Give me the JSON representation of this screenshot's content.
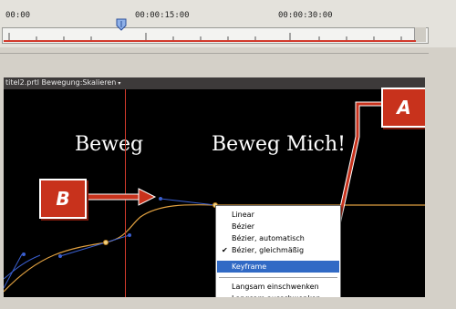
{
  "timeline": {
    "timecodes": [
      "00:00",
      "00:00:15:00",
      "00:00:30:00"
    ]
  },
  "clip_header": {
    "clip_name": "titel2.prtl",
    "property": "Bewegung:Skalieren",
    "dropdown_glyph": "▾"
  },
  "video": {
    "title_left": "Beweg",
    "title_right": "Beweg Mich!"
  },
  "callouts": {
    "a": "A",
    "b": "B"
  },
  "context_menu": {
    "items": [
      {
        "label": "Linear",
        "checked": false,
        "selected": false
      },
      {
        "label": "Bézier",
        "checked": false,
        "selected": false
      },
      {
        "label": "Bézier, automatisch",
        "checked": false,
        "selected": false
      },
      {
        "label": "Bézier, gleichmäßig",
        "checked": true,
        "selected": false
      },
      {
        "label": "Keyframe",
        "checked": false,
        "selected": true
      },
      {
        "label": "Langsam einschwenken",
        "checked": false,
        "selected": false
      },
      {
        "label": "Langsam ausschwenken",
        "checked": false,
        "selected": false
      }
    ],
    "check_glyph": "✔"
  },
  "colors": {
    "accent_red": "#c8321c",
    "curve_orange": "#e0a040",
    "handle_blue": "#3a5fd0",
    "menu_highlight": "#316ac5"
  }
}
